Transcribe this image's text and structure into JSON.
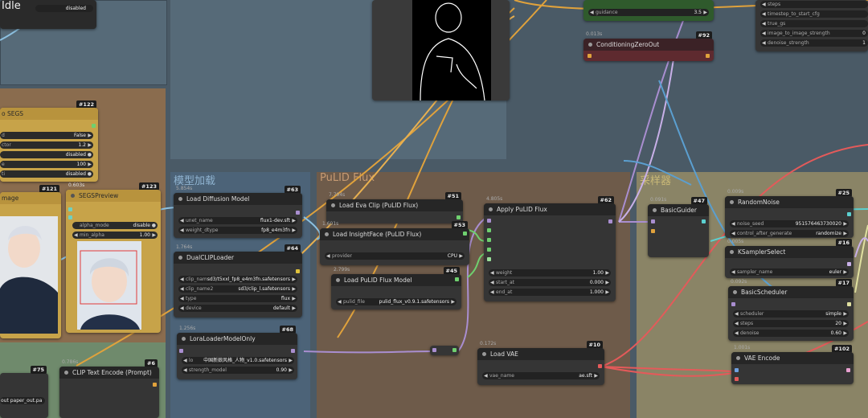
{
  "status": {
    "idle": "Idle",
    "disabled": "disabled"
  },
  "groups": {
    "model_load": "模型加载",
    "pulid": "PuLID Flux",
    "sampler": "采样器"
  },
  "nodes": {
    "segs": {
      "id": "#122",
      "title": "o SEGS",
      "rows": [
        {
          "label": "d",
          "value": "False"
        },
        {
          "label": "ctor",
          "value": "1.2"
        },
        {
          "label": "",
          "value": "disabled"
        },
        {
          "label": "e",
          "value": "100"
        },
        {
          "label": "ti",
          "value": "disabled"
        }
      ]
    },
    "image121": {
      "id": "#121",
      "title": "mage"
    },
    "segspreview": {
      "id": "#123",
      "time": "0.603s",
      "title": "SEGSPreview",
      "alpha_mode": {
        "label": "alpha_mode",
        "value": "disable"
      },
      "min_alpha": {
        "label": "min_alpha",
        "value": "1.00"
      }
    },
    "n75": {
      "id": "#75",
      "value": "out paper_out.pa"
    },
    "clip_text": {
      "id": "#6",
      "time": "0.786s",
      "title": "CLIP Text Encode (Prompt)"
    },
    "load_diffusion": {
      "id": "#63",
      "time": "5.854s",
      "title": "Load Diffusion Model",
      "unet_name": {
        "label": "unet_name",
        "value": "flux1-dev.sft"
      },
      "weight_dtype": {
        "label": "weight_dtype",
        "value": "fp8_e4m3fn"
      }
    },
    "dualclip": {
      "id": "#64",
      "time": "1.764s",
      "title": "DualCLIPLoader",
      "clip_name1": {
        "label": "clip_nam",
        "value": "sd3/t5xxl_fp8_e4m3fn.safetensors"
      },
      "clip_name2": {
        "label": "clip_name2",
        "value": "sd3/clip_l.safetensors"
      },
      "type": {
        "label": "type",
        "value": "flux"
      },
      "device": {
        "label": "device",
        "value": "default"
      }
    },
    "lora": {
      "id": "#68",
      "time": "1.256s",
      "title": "LoraLoaderModelOnly",
      "lora_name": {
        "label": "lo",
        "value": "中国新娘风格_人物_v1.0.safetensors"
      },
      "strength": {
        "label": "strength_model",
        "value": "0.90"
      }
    },
    "eva": {
      "id": "#51",
      "time": "7.794s",
      "title": "Load Eva Clip (PuLID Flux)"
    },
    "insight": {
      "id": "#53",
      "time": "1.601s",
      "title": "Load InsightFace (PuLID Flux)",
      "provider": {
        "label": "provider",
        "value": "CPU"
      }
    },
    "pulid_model": {
      "id": "#45",
      "time": "2.799s",
      "title": "Load PuLID Flux Model",
      "pulid_file": {
        "label": "pulid_file",
        "value": "pulid_flux_v0.9.1.safetensors"
      }
    },
    "apply_pulid": {
      "id": "#62",
      "time": "4.805s",
      "title": "Apply PuLID Flux",
      "weight": {
        "label": "weight",
        "value": "1.00"
      },
      "start_at": {
        "label": "start_at",
        "value": "0.000"
      },
      "end_at": {
        "label": "end_at",
        "value": "1.000"
      }
    },
    "load_vae": {
      "id": "#10",
      "time": "0.172s",
      "title": "Load VAE",
      "vae_name": {
        "label": "vae_name",
        "value": "ae.sft"
      }
    },
    "basic_guider": {
      "id": "#47",
      "time": "0.091s",
      "title": "BasicGuider"
    },
    "random_noise": {
      "id": "#25",
      "time": "0.009s",
      "title": "RandomNoise",
      "noise_seed": {
        "label": "noise_seed",
        "value": "951576463730020"
      },
      "control": {
        "label": "control_after_generate",
        "value": "randomize"
      }
    },
    "ksampler_select": {
      "id": "#16",
      "time": "0.005s",
      "title": "KSamplerSelect",
      "sampler": {
        "label": "sampler_name",
        "value": "euler"
      }
    },
    "basic_scheduler": {
      "id": "#17",
      "time": "0.092s",
      "title": "BasicScheduler",
      "scheduler": {
        "label": "scheduler",
        "value": "simple"
      },
      "steps": {
        "label": "steps",
        "value": "20"
      },
      "denoise": {
        "label": "denoise",
        "value": "0.60"
      }
    },
    "vae_encode": {
      "id": "#102",
      "time": "1.001s",
      "title": "VAE Encode"
    },
    "guidance": {
      "label": "guidance",
      "value": "3.5"
    },
    "cond_zero": {
      "id": "#92",
      "time": "0.013s",
      "title": "ConditioningZeroOut"
    },
    "right_panel": {
      "rows": [
        "steps",
        "timestep_to_start_cfg",
        "true_gs",
        "image_to_image_strength",
        "denoise_strength"
      ],
      "values": [
        "",
        "",
        "",
        "0",
        "1"
      ]
    }
  },
  "colors": {
    "canvas": "#4a5a66",
    "group_orange": "#8a6c4e",
    "group_blue": "#4c6378",
    "group_tan": "#8a8466"
  }
}
